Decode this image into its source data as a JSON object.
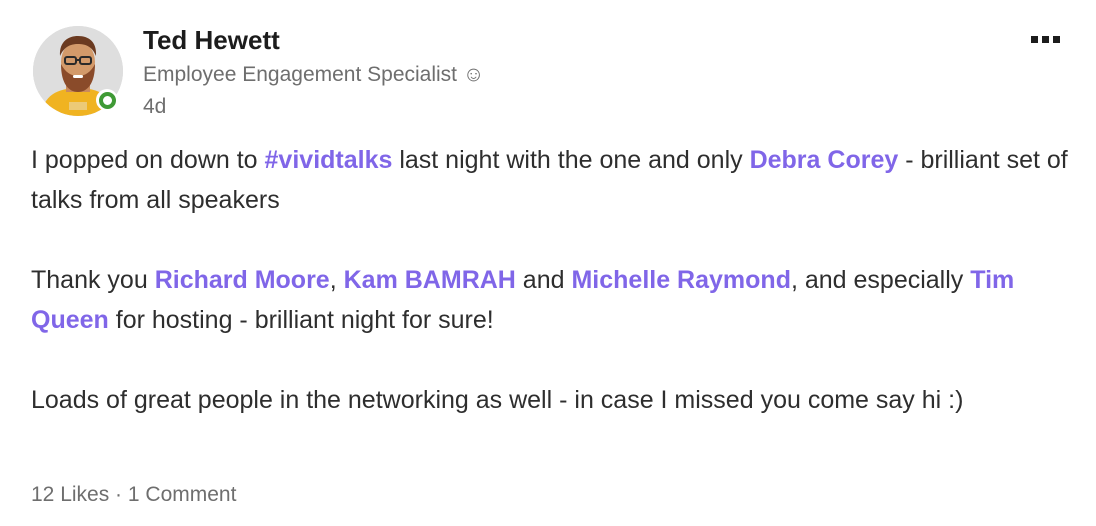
{
  "author": {
    "name": "Ted Hewett",
    "title": "Employee Engagement Specialist ☺",
    "time": "4d",
    "presence": "online",
    "avatar_icon": "user-avatar-photo"
  },
  "menu": {
    "icon": "more-horizontal-icon"
  },
  "post": {
    "p1": {
      "t1": "I popped on down to ",
      "hashtag": "#vividtalks",
      "t2": " last night with the one and only ",
      "mention1": "Debra Corey",
      "t3": " - brilliant set of talks from all speakers"
    },
    "p2": {
      "t1": "Thank you ",
      "mention1": "Richard Moore",
      "t2": ", ",
      "mention2": "Kam BAMRAH",
      "t3": " and ",
      "mention3": "Michelle Raymond",
      "t4": ", and especially ",
      "mention4": "Tim Queen",
      "t5": " for hosting - brilliant night for sure!"
    },
    "p3": {
      "t1": "Loads of great people in the networking as well - in case I missed you come say hi :)"
    }
  },
  "footer": {
    "likes": "12 Likes",
    "separator": " · ",
    "comments": "1 Comment"
  },
  "colors": {
    "mention": "#8066e8",
    "presence": "#3f9a35",
    "muted_text": "#6e6e6e"
  }
}
